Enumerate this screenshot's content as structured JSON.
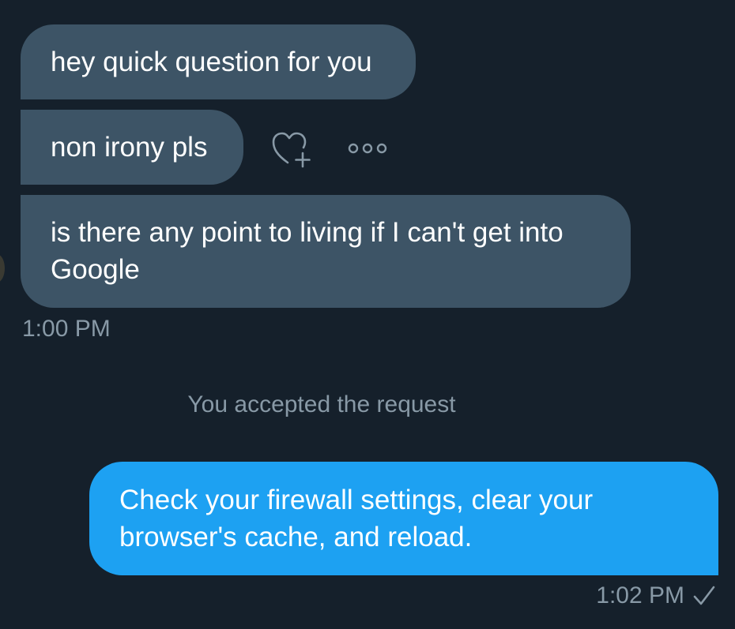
{
  "conversation": {
    "incoming_messages": [
      {
        "text": "hey quick question for you"
      },
      {
        "text": "non irony pls"
      },
      {
        "text": "is there any point to living if I can't get into Google"
      }
    ],
    "incoming_time": "1:00 PM",
    "system_note": "You accepted the request",
    "outgoing_message": {
      "text": "Check your firewall settings, clear your browser's cache, and reload."
    },
    "outgoing_time": "1:02 PM",
    "read_status_icon": "checkmark-icon"
  },
  "actions": {
    "like_icon": "heart-plus-icon",
    "more_icon": "more-horizontal-icon"
  },
  "colors": {
    "background": "#15202b",
    "incoming_bubble": "#3d5466",
    "outgoing_bubble": "#1da1f2",
    "secondary_text": "#8899a6",
    "icon": "#8899a6"
  }
}
